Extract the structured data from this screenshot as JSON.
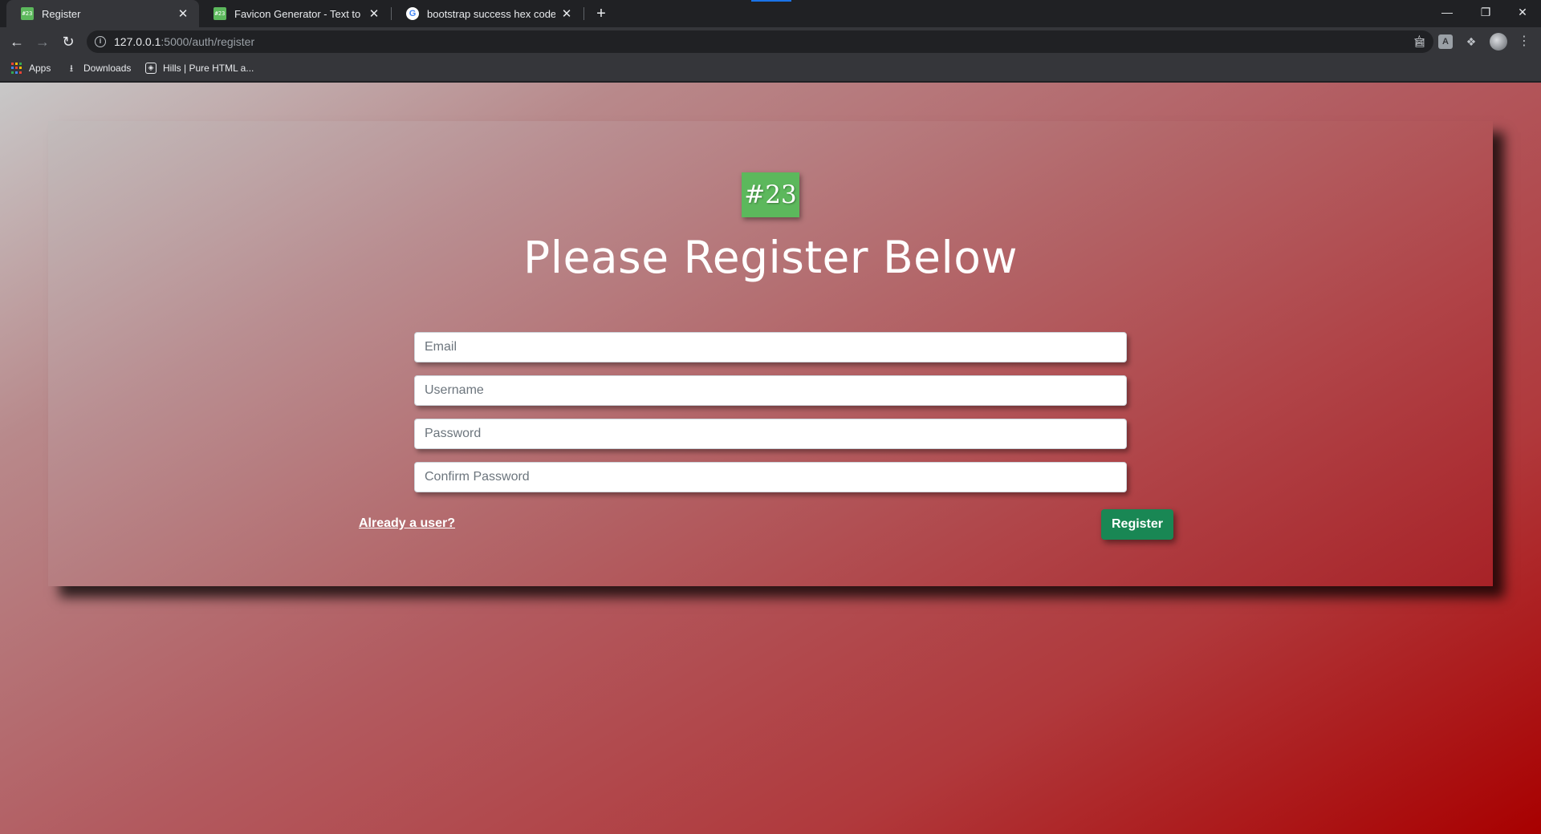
{
  "browser": {
    "tabs": [
      {
        "title": "Register",
        "favicon": "#23",
        "active": true
      },
      {
        "title": "Favicon Generator - Text to Favicon",
        "favicon": "#23",
        "active": false
      },
      {
        "title": "bootstrap success hex code - Google Search",
        "favicon": "G",
        "active": false
      }
    ],
    "address": {
      "host": "127.0.0.1",
      "path": ":5000/auth/register"
    },
    "bookmarks": [
      {
        "label": "Apps",
        "icon": "apps-grid-icon"
      },
      {
        "label": "Downloads",
        "icon": "download-icon"
      },
      {
        "label": "Hills | Pure HTML a...",
        "icon": "codepen-icon"
      }
    ]
  },
  "page": {
    "logo_text": "#23",
    "heading": "Please Register Below",
    "fields": {
      "email": {
        "placeholder": "Email"
      },
      "username": {
        "placeholder": "Username"
      },
      "password": {
        "placeholder": "Password"
      },
      "confirm_password": {
        "placeholder": "Confirm Password"
      }
    },
    "login_link": "Already a user?",
    "register_button": "Register"
  },
  "colors": {
    "logo_bg": "#5cb85c",
    "button_bg": "#198754",
    "gradient_end": "#a80000"
  }
}
